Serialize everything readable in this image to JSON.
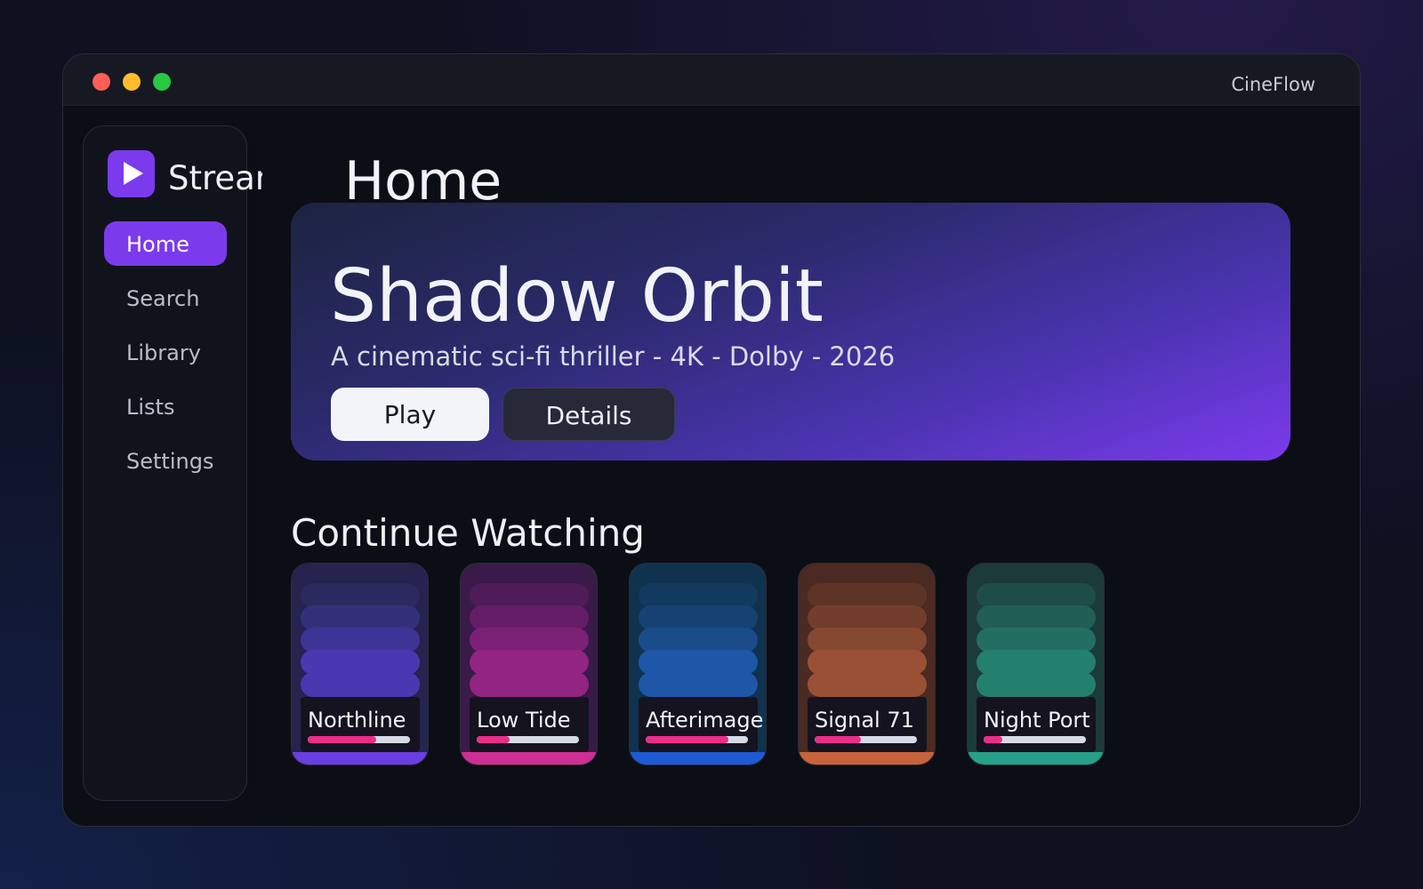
{
  "window": {
    "app_name": "CineFlow"
  },
  "sidebar": {
    "brand": "Stream",
    "items": [
      {
        "label": "Home",
        "active": true
      },
      {
        "label": "Search",
        "active": false
      },
      {
        "label": "Library",
        "active": false
      },
      {
        "label": "Lists",
        "active": false
      },
      {
        "label": "Settings",
        "active": false
      }
    ]
  },
  "main": {
    "title": "Home",
    "hero": {
      "title": "Shadow Orbit",
      "subtitle": "A cinematic sci-fi thriller - 4K - Dolby - 2026",
      "play_label": "Play",
      "details_label": "Details"
    },
    "continue_watching": {
      "title": "Continue Watching",
      "items": [
        {
          "title": "Northline",
          "progress": 0.67,
          "colors": [
            "#24244e",
            "#2a2a5e",
            "#33307a",
            "#3c3596",
            "#4a38b0",
            "#6a3ee0"
          ]
        },
        {
          "title": "Low Tide",
          "progress": 0.32,
          "colors": [
            "#3a1a48",
            "#4e1c58",
            "#641d66",
            "#7c2076",
            "#922482",
            "#d02e94"
          ]
        },
        {
          "title": "Afterimage",
          "progress": 0.81,
          "colors": [
            "#10324e",
            "#123a60",
            "#164272",
            "#1a4c8a",
            "#1e56a8",
            "#1e5ad6"
          ]
        },
        {
          "title": "Signal 71",
          "progress": 0.45,
          "colors": [
            "#4a2a22",
            "#5e3426",
            "#723e2c",
            "#864830",
            "#9a5034",
            "#c8623a"
          ]
        },
        {
          "title": "Night Port",
          "progress": 0.18,
          "colors": [
            "#1c3a3a",
            "#1e4c48",
            "#205e56",
            "#226e62",
            "#24806e",
            "#26a088"
          ]
        }
      ]
    }
  }
}
